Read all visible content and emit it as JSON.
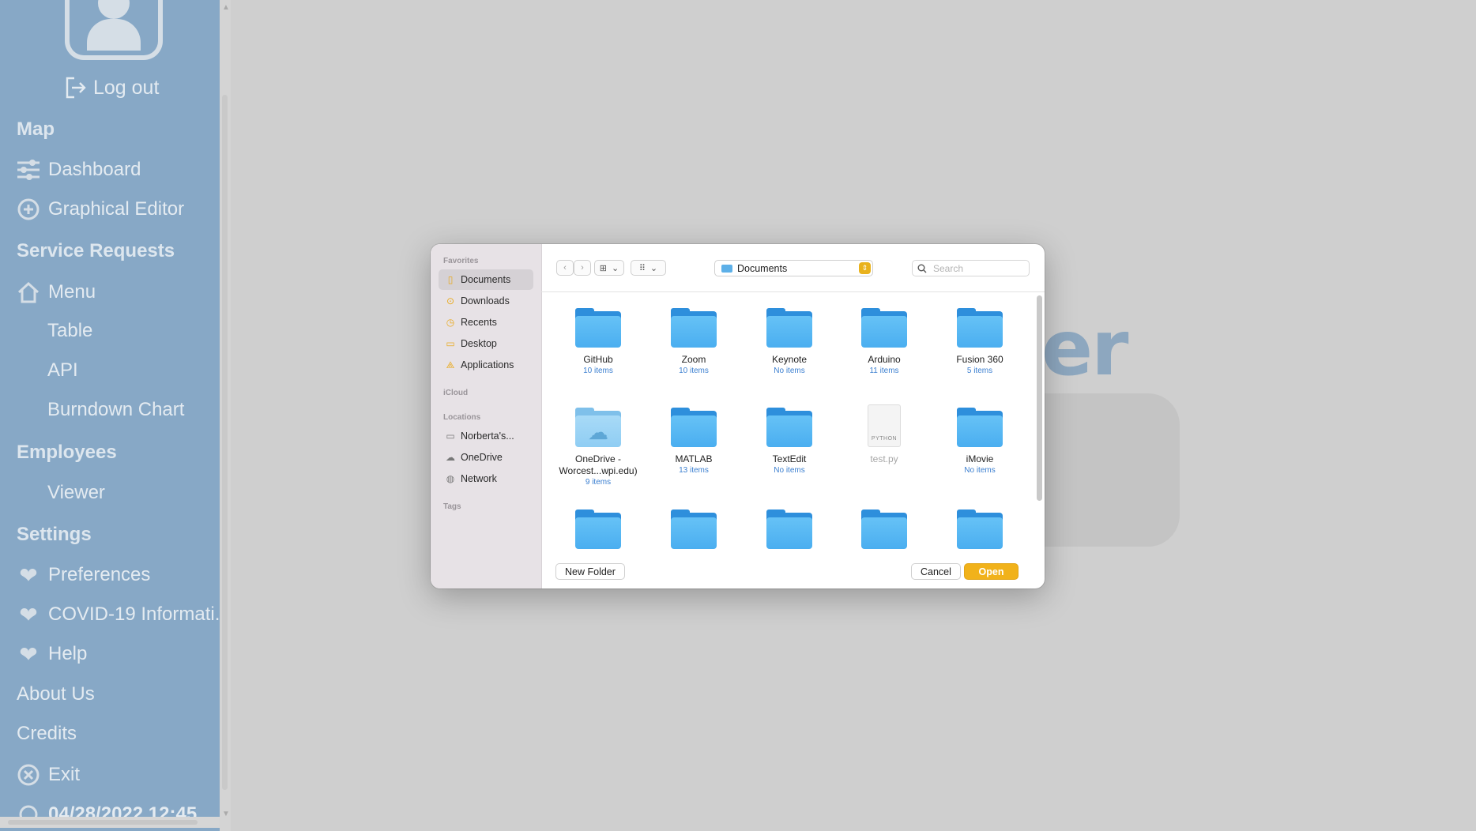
{
  "sidebar": {
    "logout_label": "Log out",
    "sections": {
      "map": "Map",
      "service_requests": "Service Requests",
      "employees": "Employees",
      "settings": "Settings"
    },
    "items": {
      "dashboard": "Dashboard",
      "graphical_editor": "Graphical Editor",
      "menu": "Menu",
      "table": "Table",
      "api": "API",
      "burndown_chart": "Burndown Chart",
      "viewer": "Viewer",
      "preferences": "Preferences",
      "covid": "COVID-19 Informati...",
      "help": "Help",
      "about_us": "About Us",
      "credits": "Credits",
      "exit": "Exit"
    },
    "clock": "04/28/2022 12:45"
  },
  "background": {
    "hero_fragment": "er"
  },
  "dialog": {
    "side": {
      "favorites_header": "Favorites",
      "favorites": [
        "Documents",
        "Downloads",
        "Recents",
        "Desktop",
        "Applications"
      ],
      "icloud_header": "iCloud",
      "locations_header": "Locations",
      "locations": [
        "Norberta's...",
        "OneDrive",
        "Network"
      ],
      "tags_header": "Tags"
    },
    "path": "Documents",
    "search_placeholder": "Search",
    "files": [
      {
        "name": "GitHub",
        "count": "10 items"
      },
      {
        "name": "Zoom",
        "count": "10 items"
      },
      {
        "name": "Keynote",
        "count": "No items"
      },
      {
        "name": "Arduino",
        "count": "11 items"
      },
      {
        "name": "Fusion 360",
        "count": "5 items"
      },
      {
        "name": "OneDrive -",
        "name2": "Worcest...wpi.edu)",
        "count": "9 items"
      },
      {
        "name": "MATLAB",
        "count": "13 items"
      },
      {
        "name": "TextEdit",
        "count": "No items"
      },
      {
        "name": "test.py",
        "kind_label": "PYTHON"
      },
      {
        "name": "iMovie",
        "count": "No items"
      }
    ],
    "buttons": {
      "new_folder": "New Folder",
      "cancel": "Cancel",
      "open": "Open"
    }
  }
}
